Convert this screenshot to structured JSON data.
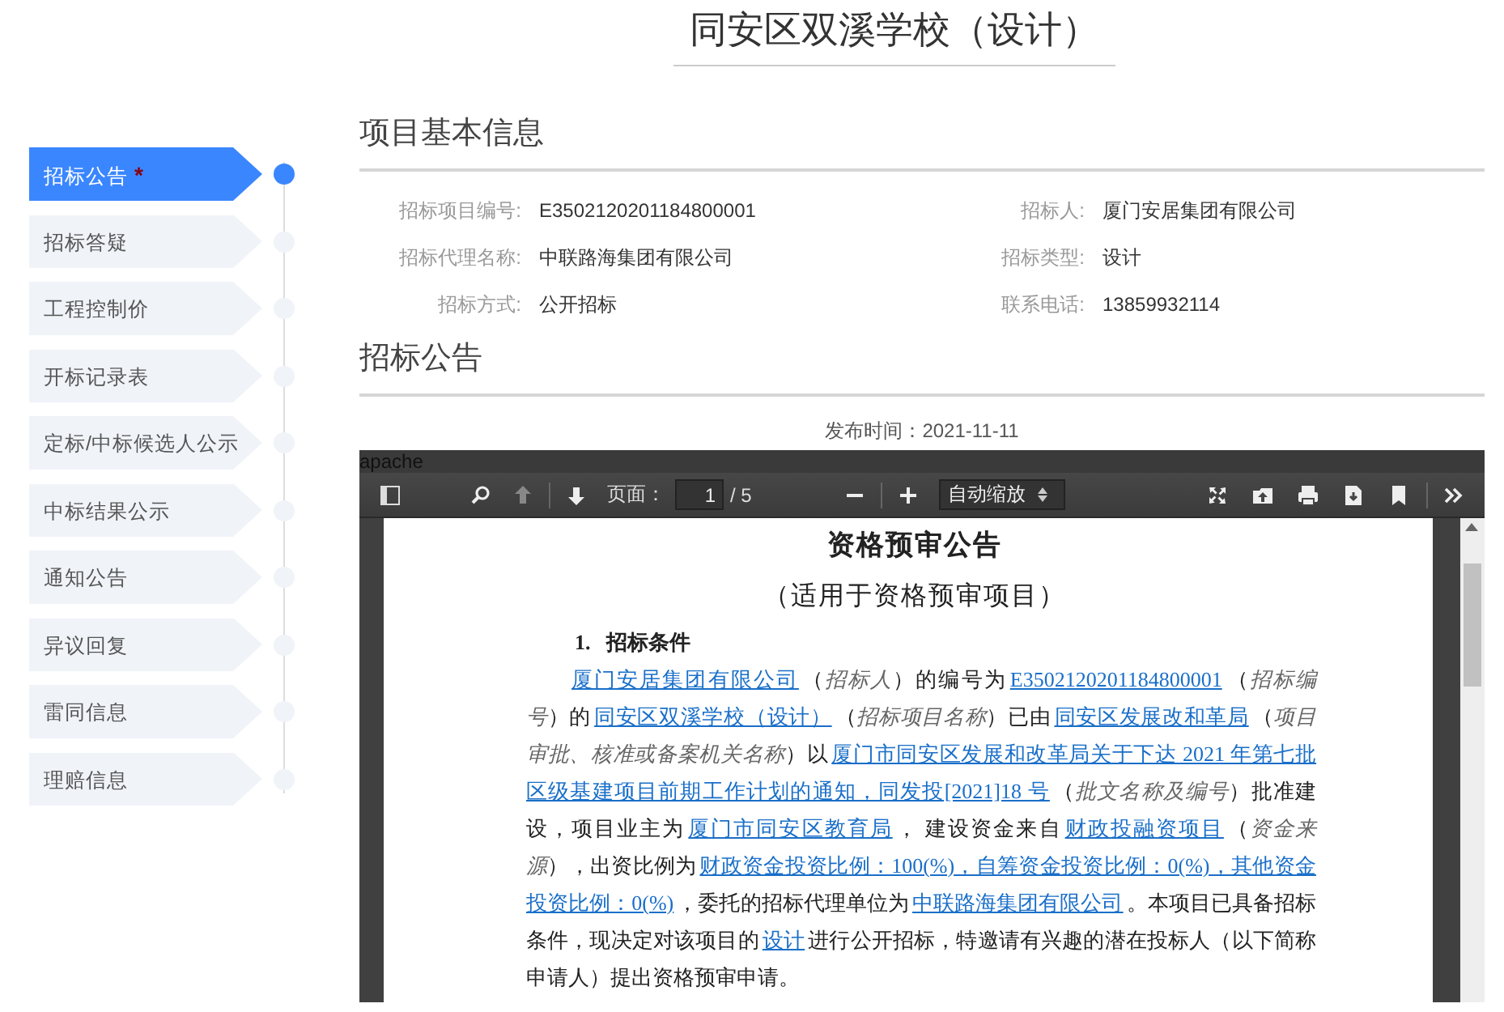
{
  "page_title": "同安区双溪学校（设计）",
  "steps": [
    {
      "label": "招标公告",
      "marker": "*",
      "selected": true
    },
    {
      "label": "招标答疑",
      "selected": false
    },
    {
      "label": "工程控制价",
      "selected": false
    },
    {
      "label": "开标记录表",
      "selected": false
    },
    {
      "label": "定标/中标候选人公示",
      "selected": false
    },
    {
      "label": "中标结果公示",
      "selected": false
    },
    {
      "label": "通知公告",
      "selected": false
    },
    {
      "label": "异议回复",
      "selected": false
    },
    {
      "label": "雷同信息",
      "selected": false
    },
    {
      "label": "理赔信息",
      "selected": false
    }
  ],
  "info": {
    "heading": "项目基本信息",
    "fields": [
      {
        "label": "招标项目编号:",
        "value": "E3502120201184800001"
      },
      {
        "label": "招标人:",
        "value": "厦门安居集团有限公司"
      },
      {
        "label": "招标代理名称:",
        "value": "中联路海集团有限公司"
      },
      {
        "label": "招标类型:",
        "value": "设计"
      },
      {
        "label": "招标方式:",
        "value": "公开招标"
      },
      {
        "label": "联系电话:",
        "value": "13859932114"
      }
    ]
  },
  "announcement": {
    "heading": "招标公告",
    "publish_label": "发布时间：",
    "publish_date": "2021-11-11"
  },
  "viewer": {
    "frame_title": "apache",
    "page_label": "页面：",
    "page_value": "1",
    "page_total": "/ 5",
    "zoom": "自动缩放",
    "document": {
      "title": "资格预审公告",
      "subtitle": "（适用于资格预审项目）",
      "section": "1.   招标条件",
      "paragraph": [
        {
          "kind": "field",
          "text": "厦门安居集团有限公司"
        },
        {
          "kind": "plain",
          "text": "（"
        },
        {
          "kind": "note",
          "text": "招标人"
        },
        {
          "kind": "plain",
          "text": "）的编号为"
        },
        {
          "kind": "field",
          "text": "E3502120201184800001"
        },
        {
          "kind": "plain",
          "text": "（"
        },
        {
          "kind": "note",
          "text": "招标编号"
        },
        {
          "kind": "plain",
          "text": "）的"
        },
        {
          "kind": "field",
          "text": "同安区双溪学校（设计）"
        },
        {
          "kind": "plain",
          "text": "（"
        },
        {
          "kind": "note",
          "text": "招标项目名称"
        },
        {
          "kind": "plain",
          "text": "）已由"
        },
        {
          "kind": "field",
          "text": "同安区发展改和革局"
        },
        {
          "kind": "plain",
          "text": "（"
        },
        {
          "kind": "note",
          "text": "项目审批、核准或备案机关名称"
        },
        {
          "kind": "plain",
          "text": "）以"
        },
        {
          "kind": "field",
          "text": "厦门市同安区发展和改革局关于下达 2021 年第七批区级基建项目前期工作计划的通知，同发投[2021]18 号"
        },
        {
          "kind": "plain",
          "text": "（"
        },
        {
          "kind": "note",
          "text": "批文名称及编号"
        },
        {
          "kind": "plain",
          "text": "）批准建设，项目业主为"
        },
        {
          "kind": "field",
          "text": "厦门市同安区教育局"
        },
        {
          "kind": "plain",
          "text": "，  建设资金来自"
        },
        {
          "kind": "field",
          "text": "财政投融资项目"
        },
        {
          "kind": "plain",
          "text": "（"
        },
        {
          "kind": "note",
          "text": "资金来源"
        },
        {
          "kind": "plain",
          "text": "），出资比例为"
        },
        {
          "kind": "field",
          "text": "财政资金投资比例：100(%)，自筹资金投资比例：0(%)，其他资金投资比例：0(%)"
        },
        {
          "kind": "plain",
          "text": "，委托的招标代理单位为"
        },
        {
          "kind": "field",
          "text": "中联路海集团有限公司"
        },
        {
          "kind": "plain",
          "text": "。本项目已具备招标条件，现决定对该项目的"
        },
        {
          "kind": "field",
          "text": "设计"
        },
        {
          "kind": "plain",
          "text": "进行公开招标，特邀请有兴趣的潜在投标人（以下简称申请人）提出资格预审申请。"
        }
      ]
    }
  }
}
